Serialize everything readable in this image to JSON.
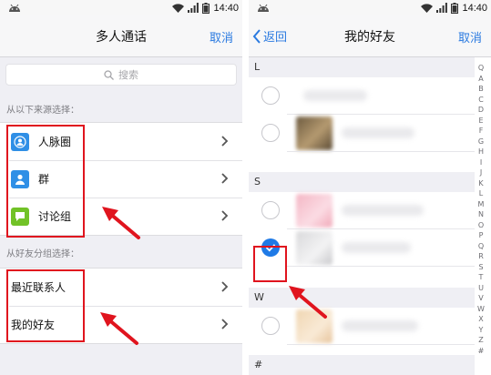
{
  "status_bar": {
    "time": "14:40",
    "icons": [
      "android-icon",
      "wifi-icon",
      "signal-icon",
      "battery-icon"
    ]
  },
  "left_screen": {
    "title": "多人通话",
    "cancel_label": "取消",
    "search_placeholder": "搜索",
    "source_section_label": "从以下来源选择：",
    "source_items": [
      {
        "label": "人脉圈",
        "icon": "contacts-icon",
        "icon_color": "#2f8fe6"
      },
      {
        "label": "群",
        "icon": "group-icon",
        "icon_color": "#2f8fe6"
      },
      {
        "label": "讨论组",
        "icon": "chat-bubble-icon",
        "icon_color": "#71c227"
      }
    ],
    "friend_section_label": "从好友分组选择：",
    "friend_group_items": [
      {
        "label": "最近联系人"
      },
      {
        "label": "我的好友"
      }
    ]
  },
  "right_screen": {
    "back_label": "返回",
    "title": "我的好友",
    "cancel_label": "取消",
    "sections": [
      {
        "letter": "L",
        "friends": [
          {
            "checked": false
          },
          {
            "checked": false
          }
        ]
      },
      {
        "letter": "S",
        "friends": [
          {
            "checked": false
          },
          {
            "checked": true
          }
        ]
      },
      {
        "letter": "W",
        "friends": [
          {
            "checked": false
          }
        ]
      },
      {
        "letter": "#",
        "friends": []
      }
    ],
    "index_letters": [
      "Q",
      "A",
      "B",
      "C",
      "D",
      "E",
      "F",
      "G",
      "H",
      "I",
      "J",
      "K",
      "L",
      "M",
      "N",
      "O",
      "P",
      "Q",
      "R",
      "S",
      "T",
      "U",
      "V",
      "W",
      "X",
      "Y",
      "Z",
      "#"
    ]
  },
  "colors": {
    "accent": "#2a7ae0",
    "highlight_red": "#e0141e",
    "check_blue": "#1f7ae6"
  }
}
